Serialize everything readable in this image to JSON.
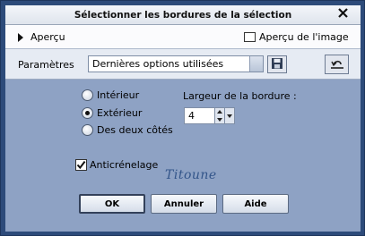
{
  "window": {
    "title": "Sélectionner les bordures de la sélection",
    "close_glyph": "X"
  },
  "preview": {
    "toggle_label": "Aperçu",
    "image_preview_label": "Aperçu de l'image",
    "image_preview_checked": false
  },
  "params": {
    "label": "Paramètres",
    "preset_value": "Dernières options utilisées",
    "save_icon": "floppy-disk-icon",
    "reset_icon": "reset-icon"
  },
  "position": {
    "options": [
      {
        "label": "Intérieur",
        "checked": false
      },
      {
        "label": "Extérieur",
        "checked": true
      },
      {
        "label": "Des deux côtés",
        "checked": false
      }
    ]
  },
  "border_width": {
    "label": "Largeur de la bordure :",
    "value": "4"
  },
  "antialias": {
    "label": "Anticrénelage",
    "checked": true
  },
  "signature": "Titoune",
  "buttons": {
    "ok": "OK",
    "cancel": "Annuler",
    "help": "Aide"
  }
}
